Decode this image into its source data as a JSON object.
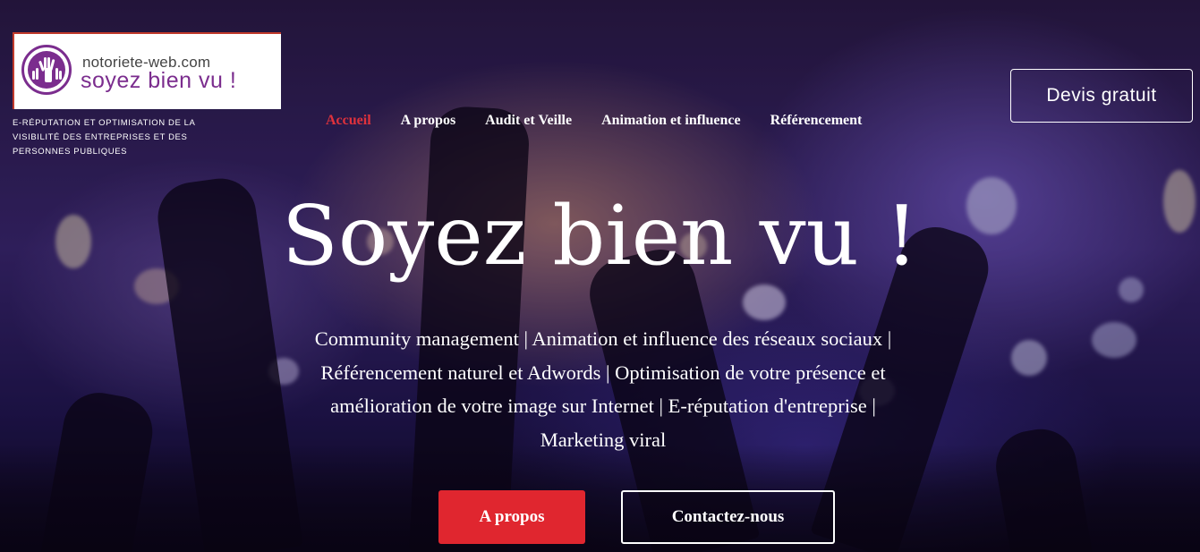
{
  "logo": {
    "domain": "notoriete-web.com",
    "slogan": "soyez bien vu !",
    "icon": "raised-hand-icon",
    "brand_color": "#7b2d8e"
  },
  "tagline": "E-RÉPUTATION ET OPTIMISATION DE LA VISIBILITÉ DES ENTREPRISES ET DES PERSONNES PUBLIQUES",
  "nav": {
    "items": [
      {
        "label": "Accueil",
        "active": true
      },
      {
        "label": "A propos",
        "active": false
      },
      {
        "label": "Audit et Veille",
        "active": false
      },
      {
        "label": "Animation et influence",
        "active": false
      },
      {
        "label": "Référencement",
        "active": false
      }
    ],
    "active_color": "#e0323c"
  },
  "header_cta": {
    "label": "Devis gratuit"
  },
  "hero": {
    "title": "Soyez bien vu !",
    "subtitle": "Community management | Animation et influence des réseaux sociaux | Référencement naturel et Adwords | Optimisation de votre présence et amélioration de votre image sur Internet | E-réputation d'entreprise | Marketing viral",
    "primary_button": "A propos",
    "secondary_button": "Contactez-nous",
    "accent_color": "#e0262f"
  }
}
